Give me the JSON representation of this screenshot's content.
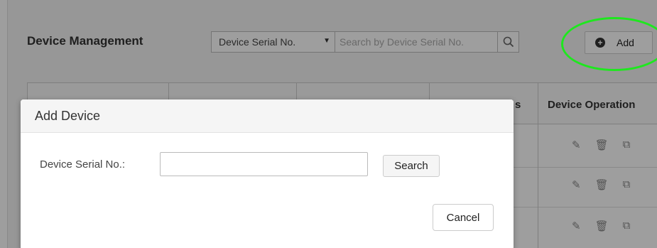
{
  "header": {
    "title": "Device Management",
    "filter_select_value": "Device Serial No.",
    "search_placeholder": "Search by Device Serial No.",
    "add_label": "Add"
  },
  "table": {
    "partial_column_header": "s",
    "operations_header": "Device Operation"
  },
  "modal": {
    "title": "Add Device",
    "field_label": "Device Serial No.:",
    "field_value": "",
    "search_label": "Search",
    "cancel_label": "Cancel"
  },
  "colors": {
    "highlight_ring": "#1ee81e",
    "overlay": "rgba(0,0,0,0.38)"
  },
  "icons": [
    "search-icon",
    "plus-circle-icon",
    "pencil-icon",
    "trash-icon",
    "copy-icon",
    "caret-down-icon"
  ]
}
